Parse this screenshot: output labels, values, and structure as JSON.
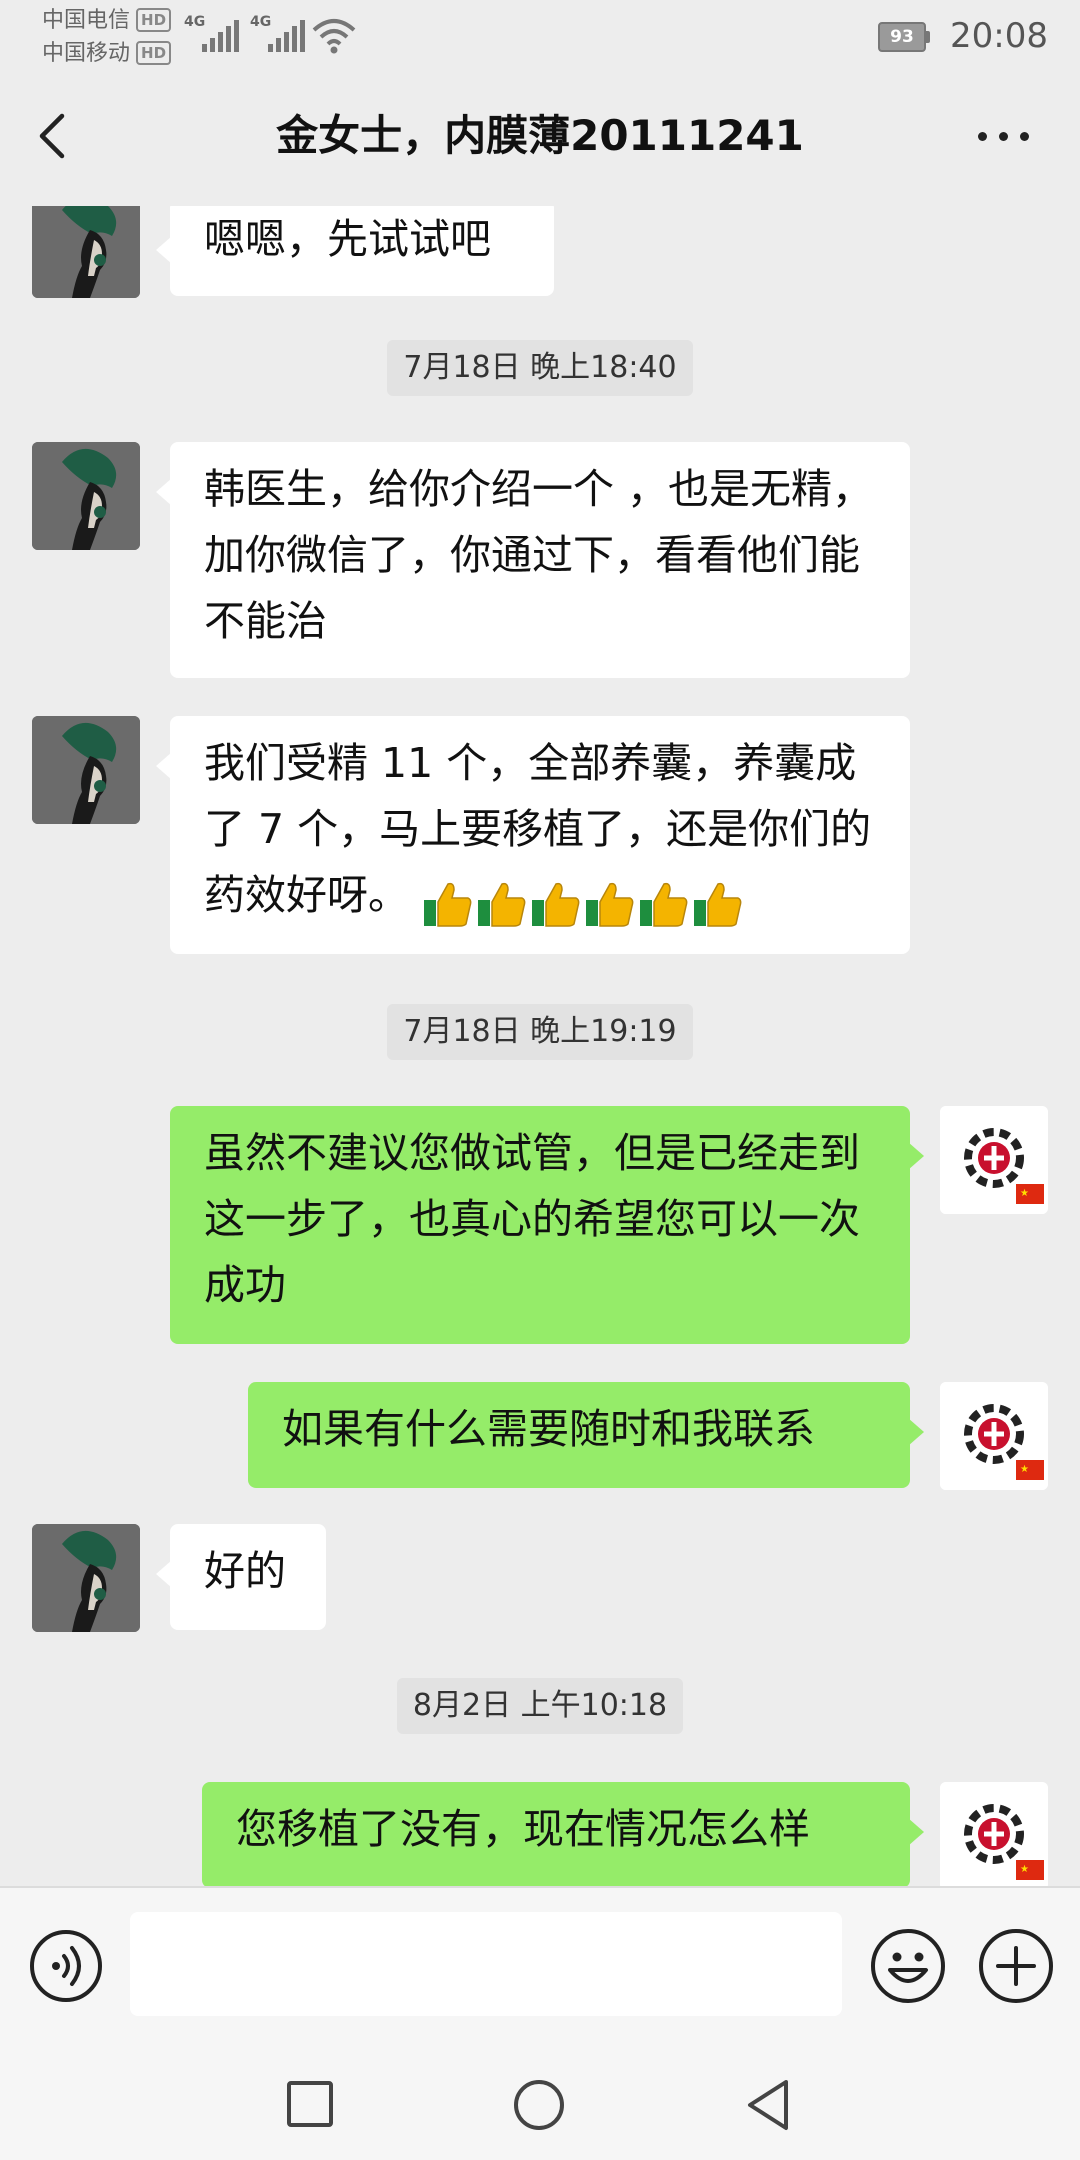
{
  "status_bar": {
    "carrier1": "中国电信",
    "carrier2": "中国移动",
    "hd_badge": "HD",
    "network1": "4G",
    "network2": "4G",
    "battery": "93",
    "time": "20:08"
  },
  "header": {
    "title": "金女士，内膜薄20111241"
  },
  "messages": {
    "m1": "嗯嗯，先试试吧",
    "t1": "7月18日 晚上18:40",
    "m2": "韩医生，给你介绍一个 ，也是无精，加你微信了，你通过下，看看他们能不能治",
    "m3": "我们受精 11 个，全部养囊，养囊成了 7 个，马上要移植了，还是你们的药效好呀。",
    "m3_emoji": "thumbs-up x6",
    "t2": "7月18日 晚上19:19",
    "m4": "虽然不建议您做试管，但是已经走到这一步了，也真心的希望您可以一次成功",
    "m5": "如果有什么需要随时和我联系",
    "m6": "好的",
    "t3": "8月2日 上午10:18",
    "m7": "您移植了没有，现在情况怎么样"
  },
  "input_bar": {
    "placeholder": ""
  },
  "colors": {
    "background": "#ededed",
    "bubble_sent": "#95ec69",
    "bubble_received": "#ffffff",
    "time_badge": "#e2e2e2"
  },
  "icons": {
    "back": "chevron-left-icon",
    "more": "more-icon",
    "voice": "voice-icon",
    "emoji": "emoji-icon",
    "plus": "plus-icon",
    "thumbs": "thumbs-up-icon"
  }
}
